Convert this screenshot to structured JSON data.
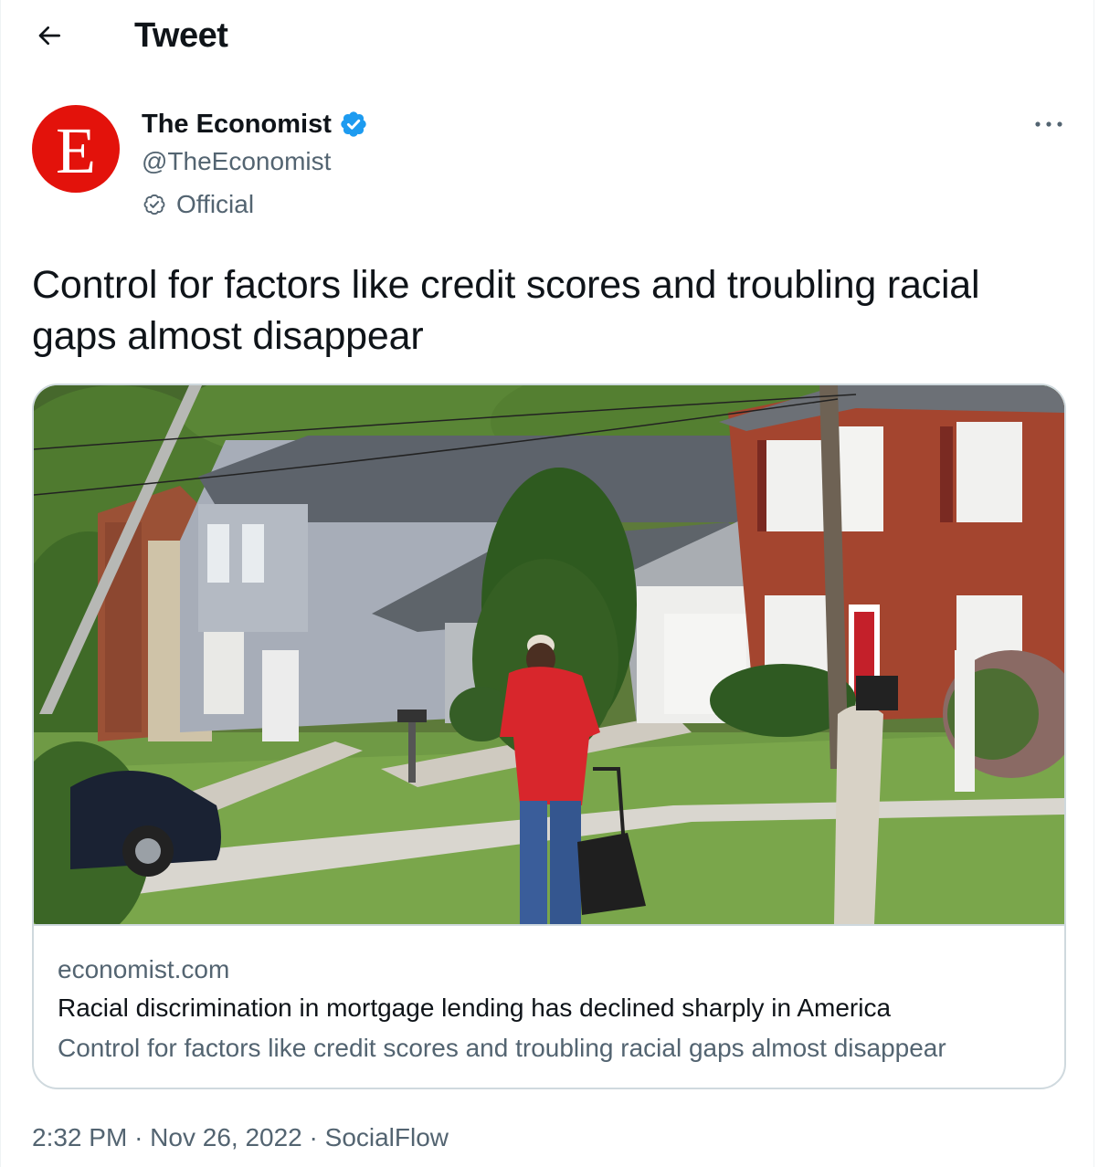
{
  "header": {
    "title": "Tweet"
  },
  "author": {
    "name": "The Economist",
    "handle": "@TheEconomist",
    "label": "Official",
    "avatar_letter": "E",
    "avatar_color": "#e3120b"
  },
  "tweet": {
    "text": "Control for factors like credit scores and troubling racial gaps almost disappear"
  },
  "card": {
    "domain": "economist.com",
    "title": "Racial discrimination in mortgage lending has declined sharply in America",
    "description": "Control for factors like credit scores and troubling racial gaps almost disappear"
  },
  "meta": {
    "time": "2:32 PM",
    "separator": "·",
    "date": "Nov 26, 2022",
    "source": "SocialFlow"
  },
  "colors": {
    "text_primary": "#0f1419",
    "text_secondary": "#536471",
    "verified_blue": "#1d9bf0",
    "border": "#cfd9de"
  },
  "icons": {
    "back": "arrow-left-icon",
    "verified": "verified-badge-icon",
    "official": "official-badge-icon",
    "more": "more-horizontal-icon"
  }
}
